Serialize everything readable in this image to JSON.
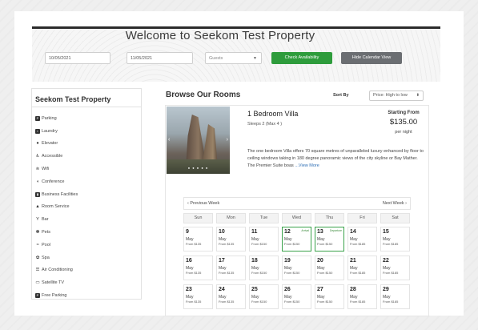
{
  "header": {
    "title": "Welcome to Seekom Test Property",
    "checkin_value": "10/05/2021",
    "checkout_value": "11/05/2021",
    "guests_placeholder": "Guests",
    "check_availability_label": "Check Availability",
    "hide_calendar_label": "Hide Calendar View"
  },
  "sidebar": {
    "title": "Seekom Test Property",
    "amenities": [
      {
        "label": "Parking",
        "icon": "parking-icon"
      },
      {
        "label": "Laundry",
        "icon": "laundry-icon"
      },
      {
        "label": "Elevator",
        "icon": "elevator-icon"
      },
      {
        "label": "Accessible",
        "icon": "wheelchair-icon"
      },
      {
        "label": "Wifi",
        "icon": "wifi-icon"
      },
      {
        "label": "Conference",
        "icon": "conference-icon"
      },
      {
        "label": "Business Facilities",
        "icon": "business-icon"
      },
      {
        "label": "Room Service",
        "icon": "room-service-icon"
      },
      {
        "label": "Bar",
        "icon": "bar-icon"
      },
      {
        "label": "Pets",
        "icon": "paw-icon"
      },
      {
        "label": "Pool",
        "icon": "pool-icon"
      },
      {
        "label": "Spa",
        "icon": "spa-icon"
      },
      {
        "label": "Air Conditioning",
        "icon": "air-conditioning-icon"
      },
      {
        "label": "Satellite TV",
        "icon": "tv-icon"
      },
      {
        "label": "Free Parking",
        "icon": "free-parking-icon"
      }
    ]
  },
  "main": {
    "title": "Browse Our Rooms",
    "sort_label": "Sort By",
    "sort_value": "Price: High to low"
  },
  "room": {
    "name": "1 Bedroom Villa",
    "sleeps": "Sleeps 2 (Max 4 )",
    "starting_from": "Starting From",
    "price": "$135.00",
    "per": "per night",
    "description": "The one bedroom Villa offers 70 square metres of unparalleled luxury enhanced by floor to ceiling windows taking in 180 degree panoramic views of the city skyline or Bay Mather. The Premier Suite boas",
    "view_more": "...View More"
  },
  "calendar": {
    "prev_label": "‹ Previous Week",
    "next_label": "Next Week ›",
    "weekdays": [
      "Sun",
      "Mon",
      "Tue",
      "Wed",
      "Thu",
      "Fri",
      "Sat"
    ],
    "weeks": [
      [
        {
          "num": "9",
          "mon": "May",
          "price": "From $135"
        },
        {
          "num": "10",
          "mon": "May",
          "price": "From $135"
        },
        {
          "num": "11",
          "mon": "May",
          "price": "From $150"
        },
        {
          "num": "12",
          "mon": "May",
          "price": "From $150",
          "tag": "Arrival",
          "selected": true
        },
        {
          "num": "13",
          "mon": "May",
          "price": "From $150",
          "tag": "Departure",
          "selected": true
        },
        {
          "num": "14",
          "mon": "May",
          "price": "From $185"
        },
        {
          "num": "15",
          "mon": "May",
          "price": "From $185"
        }
      ],
      [
        {
          "num": "16",
          "mon": "May",
          "price": "From $135"
        },
        {
          "num": "17",
          "mon": "May",
          "price": "From $135"
        },
        {
          "num": "18",
          "mon": "May",
          "price": "From $150"
        },
        {
          "num": "19",
          "mon": "May",
          "price": "From $150"
        },
        {
          "num": "20",
          "mon": "May",
          "price": "From $150"
        },
        {
          "num": "21",
          "mon": "May",
          "price": "From $185"
        },
        {
          "num": "22",
          "mon": "May",
          "price": "From $185"
        }
      ],
      [
        {
          "num": "23",
          "mon": "May",
          "price": "From $135"
        },
        {
          "num": "24",
          "mon": "May",
          "price": "From $135"
        },
        {
          "num": "25",
          "mon": "May",
          "price": "From $150"
        },
        {
          "num": "26",
          "mon": "May",
          "price": "From $150"
        },
        {
          "num": "27",
          "mon": "May",
          "price": "From $150"
        },
        {
          "num": "28",
          "mon": "May",
          "price": "From $185"
        },
        {
          "num": "29",
          "mon": "May",
          "price": "From $185"
        }
      ]
    ]
  },
  "colors": {
    "accent_green": "#2e9c3c",
    "button_gray": "#6b6e72",
    "link_blue": "#2f6fb5"
  }
}
